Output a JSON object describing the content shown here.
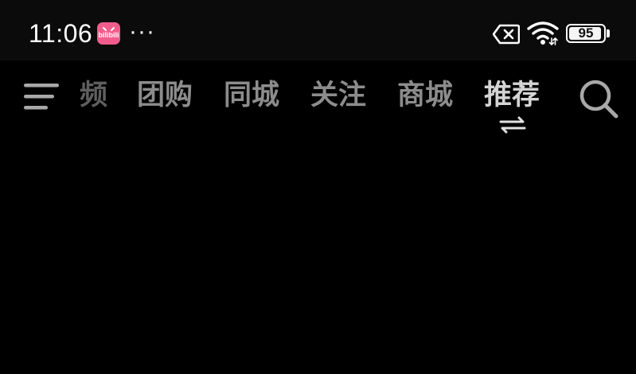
{
  "status_bar": {
    "time": "11:06",
    "notification_app_icon": "bilibili-icon",
    "notification_app_label": "bilibili",
    "more_indicator": "···",
    "icons": [
      "sim-error-icon",
      "wifi-icon"
    ],
    "battery_level": 95,
    "battery_text": "95"
  },
  "nav": {
    "menu_icon": "menu-icon",
    "tabs": [
      {
        "label": "频",
        "state": "clipped"
      },
      {
        "label": "团购",
        "state": "inactive"
      },
      {
        "label": "同城",
        "state": "inactive"
      },
      {
        "label": "关注",
        "state": "inactive"
      },
      {
        "label": "商城",
        "state": "inactive"
      },
      {
        "label": "推荐",
        "state": "active"
      }
    ],
    "active_tab_indicator_icon": "swap-arrows-icon",
    "search_icon": "search-icon"
  },
  "colors": {
    "background": "#000000",
    "status_bar_background": "#0b0b0b",
    "tab_inactive": "#8c8c8c",
    "tab_active": "#d4d4d4",
    "app_icon_pink": "#f25d8e"
  }
}
